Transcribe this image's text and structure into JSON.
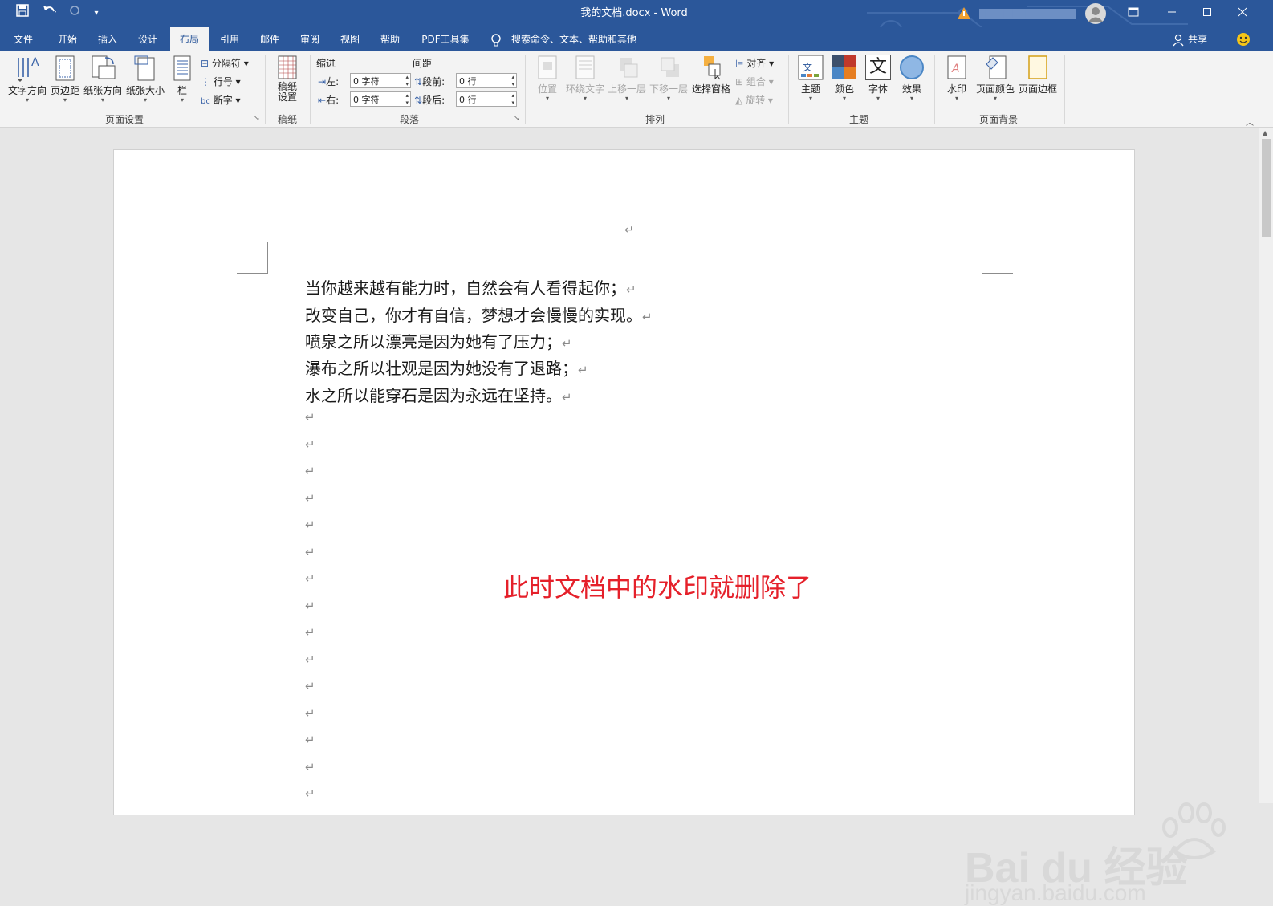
{
  "titlebar": {
    "title": "我的文档.docx - Word",
    "restore_icon": "ribbon-display-icon",
    "minimize": "—",
    "maximize": "☐",
    "close": "✕",
    "user_blurred": "████ ███"
  },
  "tabs": [
    {
      "label": "文件"
    },
    {
      "label": "开始"
    },
    {
      "label": "插入"
    },
    {
      "label": "设计"
    },
    {
      "label": "布局"
    },
    {
      "label": "引用"
    },
    {
      "label": "邮件"
    },
    {
      "label": "审阅"
    },
    {
      "label": "视图"
    },
    {
      "label": "帮助"
    },
    {
      "label": "PDF工具集"
    }
  ],
  "active_tab": "布局",
  "tell_me": "搜索命令、文本、帮助和其他",
  "share_label": "共享",
  "ribbon": {
    "page_setup": {
      "group_label": "页面设置",
      "text_direction": "文字方向",
      "margins": "页边距",
      "orientation": "纸张方向",
      "size": "纸张大小",
      "columns": "栏",
      "breaks": "分隔符",
      "line_numbers": "行号",
      "hyphenation": "断字"
    },
    "manuscript": {
      "group_label": "稿纸",
      "settings_line1": "稿纸",
      "settings_line2": "设置"
    },
    "paragraph": {
      "group_label": "段落",
      "indent_heading": "缩进",
      "spacing_heading": "间距",
      "left_label": "左:",
      "right_label": "右:",
      "before_label": "段前:",
      "after_label": "段后:",
      "left_value": "0 字符",
      "right_value": "0 字符",
      "before_value": "0 行",
      "after_value": "0 行"
    },
    "arrange": {
      "group_label": "排列",
      "position": "位置",
      "wrap_text": "环绕文字",
      "bring_forward": "上移一层",
      "send_backward": "下移一层",
      "selection_pane": "选择窗格",
      "align": "对齐",
      "group": "组合",
      "rotate": "旋转"
    },
    "themes": {
      "group_label": "主题",
      "themes": "主题",
      "colors": "颜色",
      "fonts": "字体",
      "effects": "效果",
      "fonts_glyph": "文"
    },
    "page_background": {
      "group_label": "页面背景",
      "watermark": "水印",
      "page_color": "页面颜色",
      "page_borders": "页面边框"
    }
  },
  "document": {
    "header_mark": "↵",
    "paragraphs": [
      {
        "text": "当你越来越有能力时，自然会有人看得起你；",
        "mark": "↵"
      },
      {
        "text": "改变自己，你才有自信，梦想才会慢慢的实现。",
        "mark": "↵"
      },
      {
        "text": "喷泉之所以漂亮是因为她有了压力；",
        "mark": "↵"
      },
      {
        "text": "瀑布之所以壮观是因为她没有了退路；",
        "mark": "↵"
      },
      {
        "text": "水之所以能穿石是因为永远在坚持。",
        "mark": "↵"
      }
    ],
    "empty_mark": "↵",
    "empty_count": 15
  },
  "annotation": "此时文档中的水印就删除了",
  "watermark": {
    "line1": "Bai du 经验",
    "line2": "jingyan.baidu.com"
  },
  "colors": {
    "titlebar": "#2b579a",
    "annotation": "#e5202a"
  }
}
